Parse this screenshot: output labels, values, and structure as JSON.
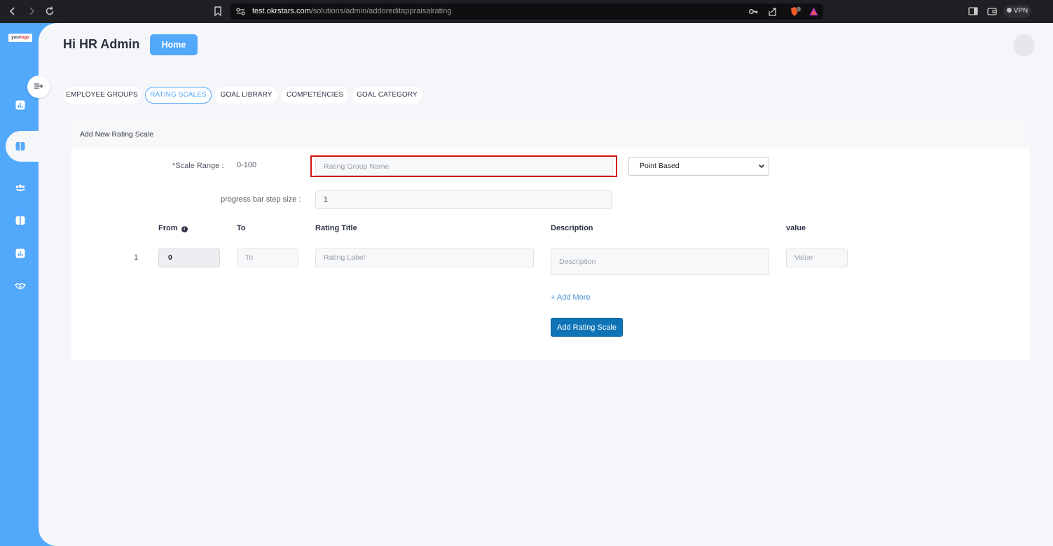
{
  "browser": {
    "url_host": "test.okrstars.com",
    "url_path": "/solutions/admin/addoreditappraisalrating",
    "vpn_label": "VPN",
    "brave_badge": "1"
  },
  "sidebar": {
    "logo_text_1": "your",
    "logo_text_2": "logo",
    "items": [
      {
        "icon": "chart-icon"
      },
      {
        "icon": "book-icon",
        "active": true
      },
      {
        "icon": "users-icon"
      },
      {
        "icon": "book-icon"
      },
      {
        "icon": "chart-icon"
      },
      {
        "icon": "handshake-icon"
      }
    ]
  },
  "header": {
    "greeting": "Hi HR Admin",
    "home_label": "Home"
  },
  "tabs": [
    {
      "label": "EMPLOYEE GROUPS"
    },
    {
      "label": "RATING SCALES",
      "active": true
    },
    {
      "label": "GOAL LIBRARY"
    },
    {
      "label": "COMPETENCIES"
    },
    {
      "label": "GOAL CATEGORY"
    }
  ],
  "form": {
    "title": "Add New Rating Scale",
    "scale_range_label": "*Scale Range :",
    "scale_range_value": "0-100",
    "rating_group_placeholder": "Rating Group Name",
    "scale_type_selected": "Point Based",
    "step_size_label": "progress bar step size :",
    "step_size_value": "1",
    "columns": {
      "from": "From",
      "to": "To",
      "rating_title": "Rating Title",
      "description": "Description",
      "value": "value"
    },
    "rows": [
      {
        "index": "1",
        "from": "0",
        "to_placeholder": "To",
        "label_placeholder": "Rating Label",
        "description_placeholder": "Description",
        "value_placeholder": "Value"
      }
    ],
    "add_more_label": "+ Add More",
    "submit_label": "Add Rating Scale"
  },
  "colors": {
    "accent": "#52a8fa",
    "primary_button": "#0e74b7",
    "highlight_box": "#d40f0f"
  }
}
